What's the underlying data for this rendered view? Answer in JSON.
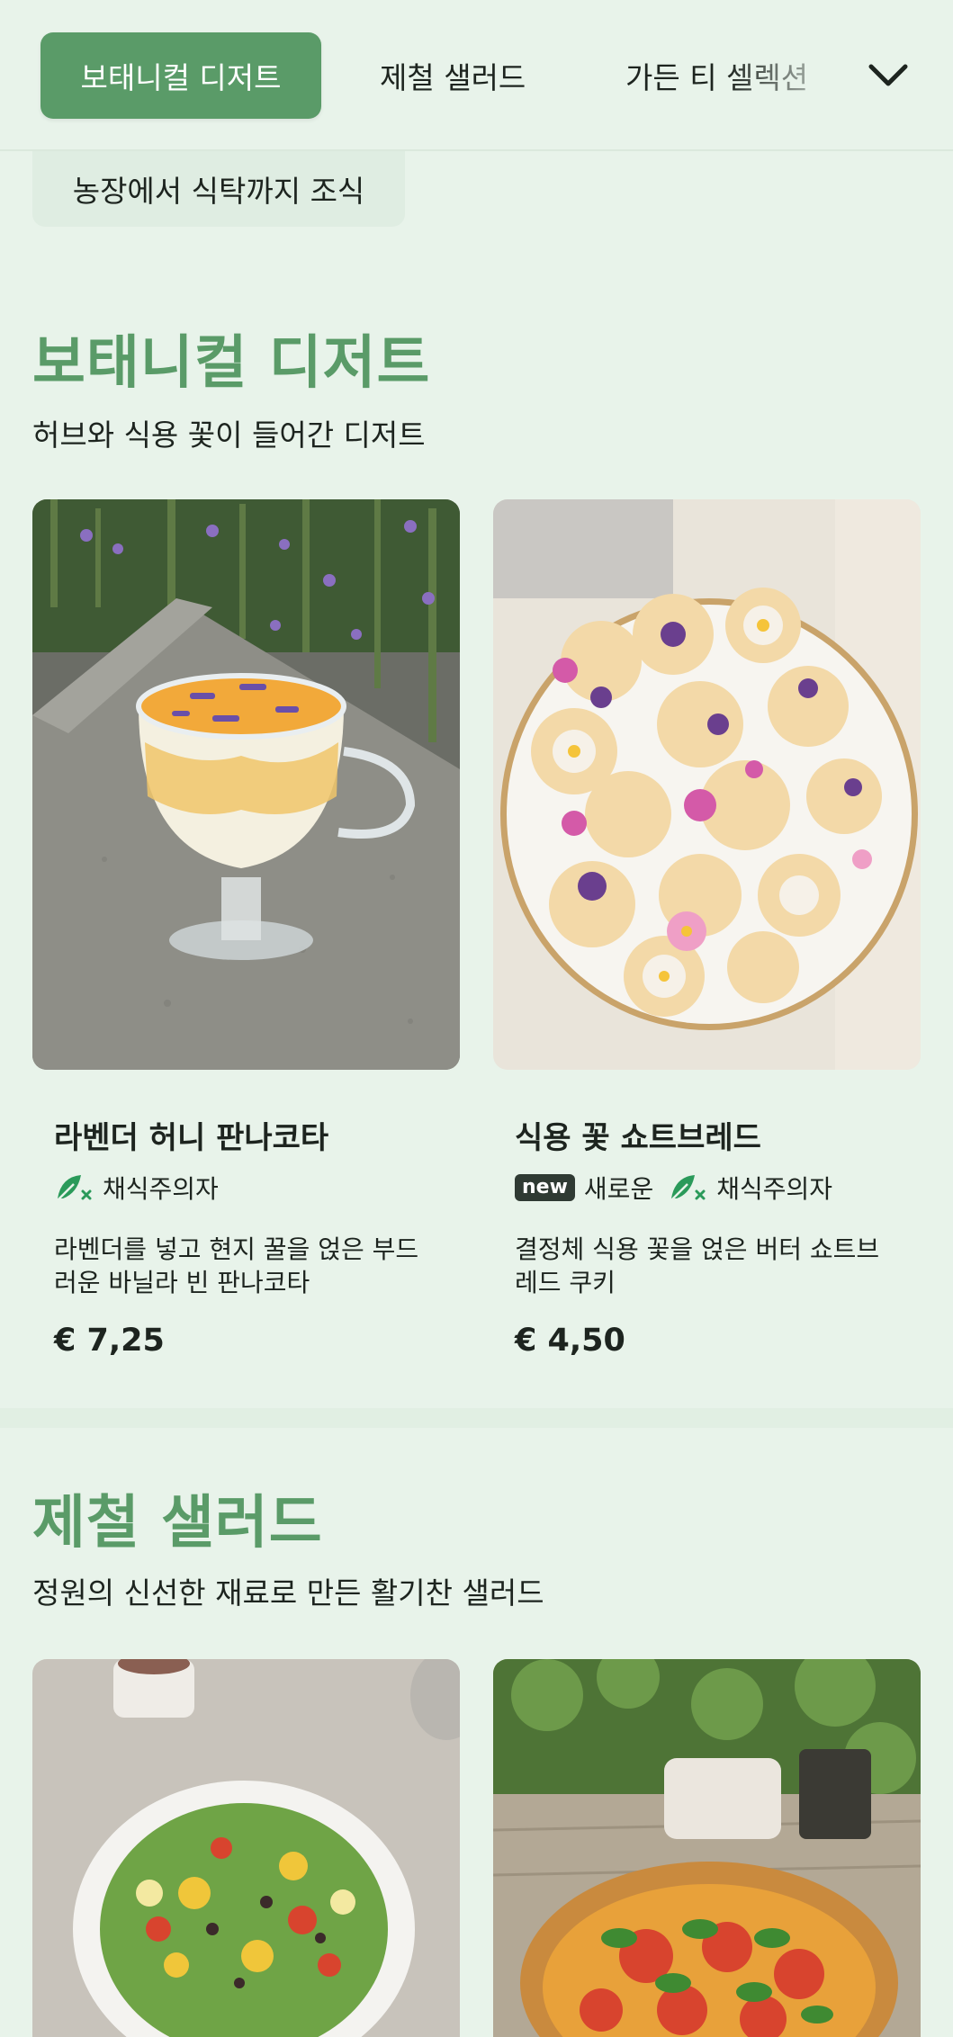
{
  "nav": {
    "tabs": [
      {
        "label": "보태니컬 디저트",
        "active": true
      },
      {
        "label": "제철 샐러드",
        "active": false
      },
      {
        "label": "가든 티 셀렉션",
        "active": false
      }
    ],
    "more_icon": "chevron-down-icon",
    "chip": "농장에서 식탁까지 조식"
  },
  "sections": [
    {
      "title": "보태니컬 디저트",
      "subtitle": "허브와 식용 꽃이 들어간 디저트",
      "items": [
        {
          "name": "라벤더 허니 판나코타",
          "badges": [],
          "diet": "채식주의자",
          "description": "라벤더를 넣고 현지 꿀을 얹은 부드러운 바닐라 빈 판나코타",
          "price": "€ 7,25"
        },
        {
          "name": "식용 꽃 쇼트브레드",
          "badges": [
            "new"
          ],
          "badge_label": "새로운",
          "diet": "채식주의자",
          "description": "결정체 식용 꽃을 얹은 버터 쇼트브레드 쿠키",
          "price": "€ 4,50"
        }
      ]
    },
    {
      "title": "제철 샐러드",
      "subtitle": "정원의 신선한 재료로 만든 활기찬 샐러드"
    }
  ],
  "colors": {
    "background": "#e8f3ea",
    "accent": "#5a9b68",
    "text": "#1d241f",
    "vegetarian_icon": "#2a9a5a"
  }
}
